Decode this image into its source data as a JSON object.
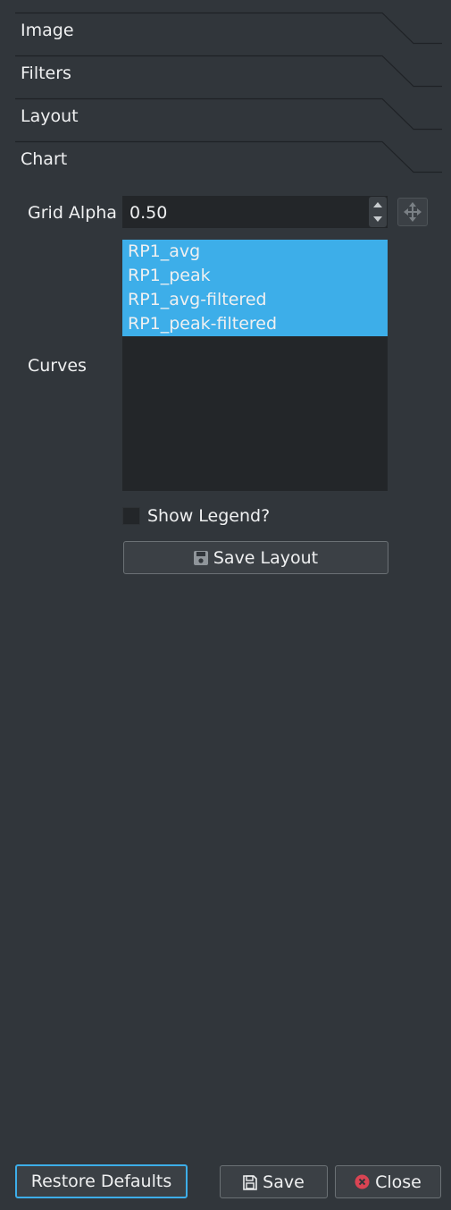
{
  "sections": [
    {
      "label": "Image"
    },
    {
      "label": "Filters"
    },
    {
      "label": "Layout"
    },
    {
      "label": "Chart"
    }
  ],
  "chart": {
    "grid_alpha": {
      "label": "Grid Alpha",
      "value": "0.50"
    },
    "curves": {
      "label": "Curves",
      "items": [
        "RP1_avg",
        "RP1_peak",
        "RP1_avg-filtered",
        "RP1_peak-filtered"
      ],
      "selected": [
        "RP1_avg",
        "RP1_peak",
        "RP1_avg-filtered",
        "RP1_peak-filtered"
      ]
    },
    "show_legend": {
      "label": "Show Legend?",
      "checked": false
    },
    "save_layout": {
      "label": "Save Layout",
      "icon": "floppy-disk-icon"
    }
  },
  "footer": {
    "restore_defaults": "Restore Defaults",
    "save": {
      "label": "Save",
      "icon": "save-icon"
    },
    "close": {
      "label": "Close",
      "icon": "close-circle-icon"
    }
  },
  "colors": {
    "background": "#31363b",
    "field": "#232629",
    "selection": "#3daee9",
    "button": "#3b4045",
    "close_icon": "#da4453",
    "text": "#eff0f1"
  }
}
